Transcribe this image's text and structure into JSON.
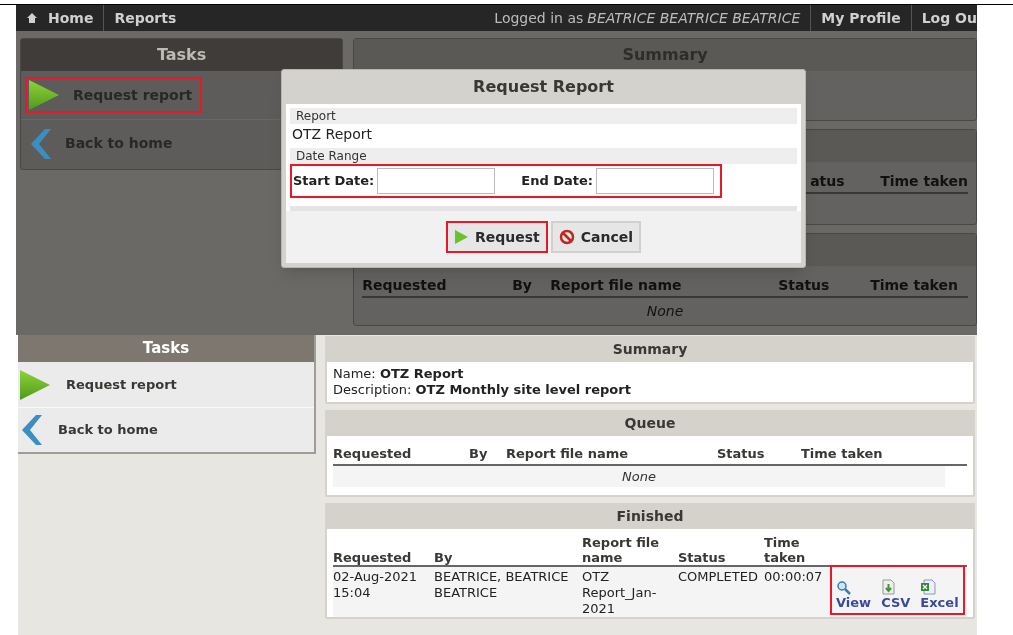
{
  "top_screen": {
    "nav": {
      "home": "Home",
      "reports": "Reports",
      "logged_in_label": "Logged in as",
      "user": "BEATRICE BEATRICE BEATRICE",
      "profile": "My Profile",
      "logout": "Log Ou"
    },
    "tasks": {
      "title": "Tasks",
      "items": [
        {
          "kind": "play",
          "label": "Request report",
          "highlighted": true
        },
        {
          "kind": "back",
          "label": "Back to home",
          "highlighted": false
        }
      ]
    },
    "summary_title": "Summary",
    "queue_columns": [
      "atus",
      "Time taken"
    ],
    "finished_columns": [
      "Requested",
      "By",
      "Report file name",
      "Status",
      "Time taken"
    ],
    "finished_empty": "None",
    "dialog": {
      "title": "Request Report",
      "report_label": "Report",
      "report_value": "OTZ Report",
      "date_range_label": "Date Range",
      "start_label": "Start Date:",
      "end_label": "End Date:",
      "dates_highlighted": true,
      "buttons": [
        {
          "kind": "request",
          "label": "Request",
          "highlighted": true
        },
        {
          "kind": "cancel",
          "label": "Cancel",
          "highlighted": false
        }
      ]
    }
  },
  "bottom_screen": {
    "tasks": {
      "title": "Tasks",
      "items": [
        {
          "kind": "play",
          "label": "Request report"
        },
        {
          "kind": "back",
          "label": "Back to home"
        }
      ]
    },
    "summary": {
      "title": "Summary",
      "lines": [
        "Name: **OTZ Report**",
        "Description: **OTZ Monthly site level report**"
      ]
    },
    "queue": {
      "title": "Queue",
      "columns": [
        "Requested",
        "By",
        "Report file name",
        "Status",
        "Time taken"
      ],
      "empty": "None"
    },
    "finished": {
      "title": "Finished",
      "columns": [
        "Requested",
        "By",
        "Report file name",
        "Status",
        "Time taken"
      ],
      "rows": [
        {
          "cells": [
            "02-Aug-2021 15:04",
            "BEATRICE, BEATRICE BEATRICE",
            "OTZ Report_Jan-2021",
            "COMPLETED",
            "00:00:07"
          ],
          "actions_highlighted": true,
          "actions": [
            {
              "kind": "view",
              "label": "View"
            },
            {
              "kind": "csv",
              "label": "CSV"
            },
            {
              "kind": "excel",
              "label": "Excel"
            }
          ]
        }
      ]
    }
  }
}
